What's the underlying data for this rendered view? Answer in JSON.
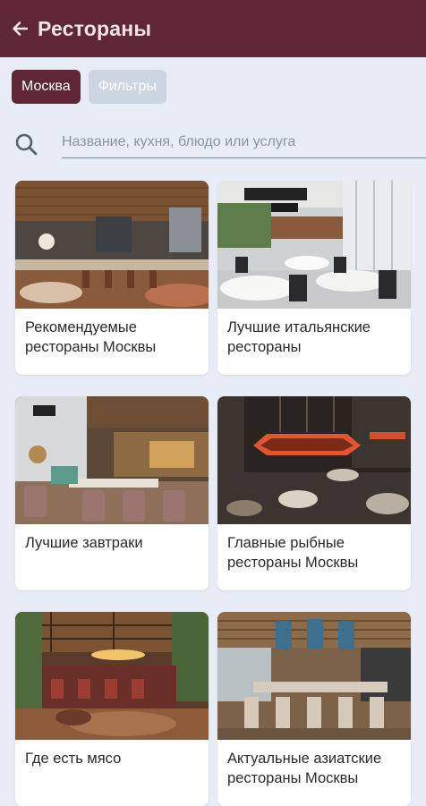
{
  "header": {
    "title": "Рестораны",
    "back_icon": "arrow-left-icon"
  },
  "chips": [
    {
      "label": "Москва",
      "active": true
    },
    {
      "label": "Фильтры",
      "active": false
    }
  ],
  "search": {
    "placeholder": "Название, кухня, блюдо или услуга",
    "value": "",
    "icon": "search-icon"
  },
  "colors": {
    "brand": "#5e2636",
    "background": "#e8ecf6",
    "chip_inactive": "#cbd6e2"
  },
  "cards": [
    {
      "title": "Рекомендуемые рестораны Москвы"
    },
    {
      "title": "Лучшие итальянские рестораны"
    },
    {
      "title": "Лучшие завтраки"
    },
    {
      "title": "Главные рыбные рестораны Москвы"
    },
    {
      "title": "Где есть мясо"
    },
    {
      "title": "Актуальные азиатские рестораны Москвы"
    }
  ]
}
